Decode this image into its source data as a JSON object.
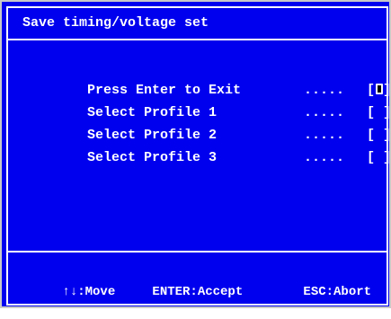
{
  "dialog": {
    "title": "Save timing/voltage set",
    "options": [
      {
        "label": "Press Enter to Exit",
        "dots": ".....",
        "bracket_open": "[",
        "marker": "",
        "bracket_close": "]",
        "selected": true
      },
      {
        "label": "Select Profile 1",
        "dots": ".....",
        "bracket_open": "[",
        "marker": " ",
        "bracket_close": "]",
        "selected": false
      },
      {
        "label": "Select Profile 2",
        "dots": ".....",
        "bracket_open": "[",
        "marker": " ",
        "bracket_close": "]",
        "selected": false
      },
      {
        "label": "Select Profile 3",
        "dots": ".....",
        "bracket_open": "[",
        "marker": " ",
        "bracket_close": "]",
        "selected": false
      }
    ],
    "footer": {
      "move": "↑↓:Move",
      "accept": "ENTER:Accept",
      "abort": "ESC:Abort"
    }
  },
  "colors": {
    "background": "#0000ee",
    "text": "#ffffff",
    "outer_border": "#c9c9c9"
  }
}
